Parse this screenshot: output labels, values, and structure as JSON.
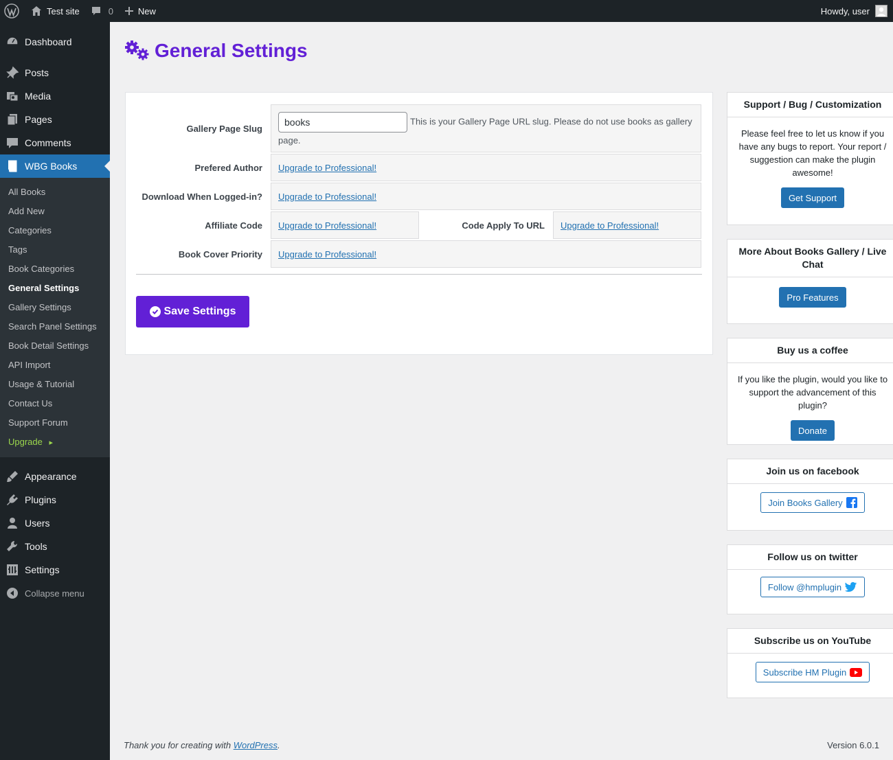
{
  "adminbar": {
    "site_name": "Test site",
    "comments_count": "0",
    "new_label": "New",
    "howdy": "Howdy, user"
  },
  "sidebar": {
    "items_top": [
      {
        "label": "Dashboard",
        "icon": "dashboard-icon"
      },
      {
        "label": "Posts",
        "icon": "pin-icon"
      },
      {
        "label": "Media",
        "icon": "media-icon"
      },
      {
        "label": "Pages",
        "icon": "pages-icon"
      },
      {
        "label": "Comments",
        "icon": "comment-icon"
      },
      {
        "label": "WBG Books",
        "icon": "book-icon"
      }
    ],
    "submenu": [
      "All Books",
      "Add New",
      "Categories",
      "Tags",
      "Book Categories",
      "General Settings",
      "Gallery Settings",
      "Search Panel Settings",
      "Book Detail Settings",
      "API Import",
      "Usage & Tutorial",
      "Contact Us",
      "Support Forum",
      "Upgrade"
    ],
    "items_bottom": [
      {
        "label": "Appearance",
        "icon": "brush-icon"
      },
      {
        "label": "Plugins",
        "icon": "plugin-icon"
      },
      {
        "label": "Users",
        "icon": "user-icon"
      },
      {
        "label": "Tools",
        "icon": "wrench-icon"
      },
      {
        "label": "Settings",
        "icon": "settings-icon"
      }
    ],
    "collapse_label": "Collapse menu"
  },
  "page": {
    "title": "General Settings"
  },
  "form": {
    "slug_label": "Gallery Page Slug",
    "slug_value": "books",
    "slug_help": "This is your Gallery Page URL slug. Please do not use books as gallery page.",
    "author_label": "Prefered Author",
    "download_label": "Download When Logged-in?",
    "affiliate_label": "Affiliate Code",
    "code_apply_label": "Code Apply To URL",
    "cover_label": "Book Cover Priority",
    "upgrade_link": "Upgrade to Professional!",
    "save_label": "Save Settings"
  },
  "boxes": {
    "support": {
      "title": "Support / Bug / Customization",
      "text": "Please feel free to let us know if you have any bugs to report. Your report / suggestion can make the plugin awesome!",
      "button": "Get Support"
    },
    "more": {
      "title": "More About Books Gallery / Live Chat",
      "button": "Pro Features"
    },
    "coffee": {
      "title": "Buy us a coffee",
      "text": "If you like the plugin, would you like to support the advancement of this plugin?",
      "button": "Donate"
    },
    "facebook": {
      "title": "Join us on facebook",
      "button": "Join Books Gallery"
    },
    "twitter": {
      "title": "Follow us on twitter",
      "button": "Follow @hmplugin"
    },
    "youtube": {
      "title": "Subscribe us on YouTube",
      "button": "Subscribe HM Plugin"
    }
  },
  "footer": {
    "thanks_prefix": "Thank you for creating with ",
    "wp_link": "WordPress",
    "thanks_suffix": ".",
    "version": "Version 6.0.1"
  },
  "colors": {
    "accent": "#6220d6",
    "wp_blue": "#2271b1",
    "admin_dark": "#1d2327",
    "upgrade_green": "#9cd74d",
    "facebook": "#1877f2",
    "twitter": "#1da1f2",
    "youtube": "#ff0000"
  }
}
